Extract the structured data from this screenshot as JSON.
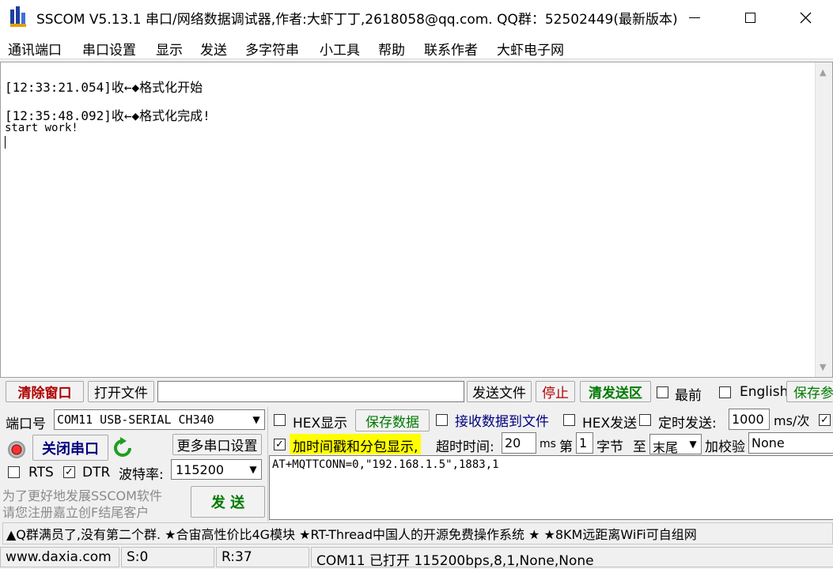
{
  "window": {
    "title": "SSCOM V5.13.1 串口/网络数据调试器,作者:大虾丁丁,2618058@qq.com. QQ群：52502449(最新版本)"
  },
  "menu": [
    "通讯端口",
    "串口设置",
    "显示",
    "发送",
    "多字符串",
    "小工具",
    "帮助",
    "联系作者",
    "大虾电子网"
  ],
  "receive": {
    "lines": [
      "[12:33:21.054]收←◆格式化开始",
      "[12:35:48.092]收←◆格式化完成!",
      "start work!"
    ]
  },
  "toolbar": {
    "clear_window": "清除窗口",
    "open_file": "打开文件",
    "file_path": "",
    "send_file": "发送文件",
    "stop": "停止",
    "clear_send": "清发送区",
    "topmost": "最前",
    "english": "English",
    "save_params": "保存参"
  },
  "port": {
    "label": "端口号",
    "value": "COM11 USB-SERIAL CH340",
    "more_settings": "更多串口设置",
    "close_port": "关闭串口",
    "rts": "RTS",
    "dtr": "DTR",
    "baud_label": "波特率:",
    "baud_value": "115200",
    "rts_checked": false,
    "dtr_checked": true
  },
  "options": {
    "hex_display": "HEX显示",
    "save_data": "保存数据",
    "recv_to_file": "接收数据到文件",
    "hex_send": "HEX发送",
    "timed_send": "定时发送:",
    "interval": "1000",
    "interval_unit": "ms/次",
    "timestamp": "加时间戳和分包显示,",
    "timeout_label": "超时时间:",
    "timeout_value": "20",
    "timeout_unit": "ms",
    "byte_prefix": "第",
    "byte_value": "1",
    "byte_label": "字节",
    "to_label": "至",
    "end_value": "末尾",
    "checksum_label": "加校验",
    "checksum_value": "None"
  },
  "send": {
    "text": "AT+MQTTCONN=0,\"192.168.1.5\",1883,1",
    "button": "发 送"
  },
  "promo": {
    "line1": "为了更好地发展SSCOM软件",
    "line2": "请您注册嘉立创F结尾客户"
  },
  "ticker": "▲Q群满员了,没有第二个群. ★合宙高性价比4G模块 ★RT-Thread中国人的开源免费操作系统 ★ ★8KM远距离WiFi可自组网",
  "status": {
    "website": "www.daxia.com",
    "sent": "S:0",
    "received": "R:37",
    "port_status": "COM11 已打开  115200bps,8,1,None,None"
  },
  "colors": {
    "accent_red": "#b00000",
    "accent_green": "#007a00",
    "highlight_yellow": "#ffff00",
    "link_blue": "#00007f"
  }
}
